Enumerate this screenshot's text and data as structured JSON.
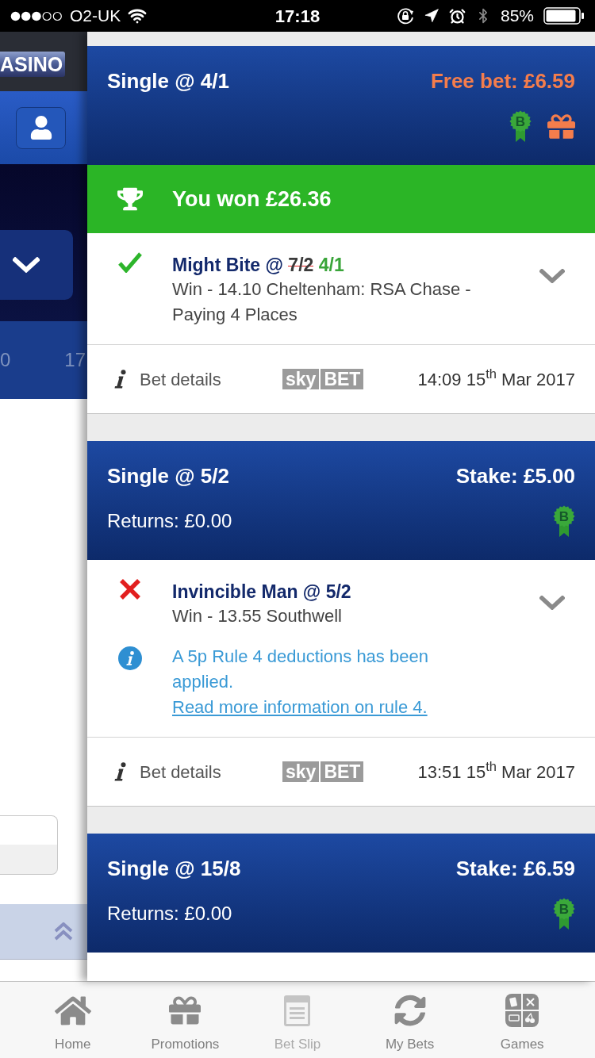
{
  "status_bar": {
    "carrier": "O2-UK",
    "time": "17:18",
    "battery": "85%"
  },
  "background_page": {
    "logo": "ASINO",
    "numbers": [
      "0",
      "17"
    ]
  },
  "bets": [
    {
      "kind": "free_bet",
      "title": "Single @ 4/1",
      "amount": "Free bet: £6.59",
      "badge": "B",
      "result_banner": "You won £26.36",
      "selection": {
        "kind": "won",
        "name": "Might Bite @",
        "old_odds": "7/2",
        "odds": "4/1",
        "price_changed": true,
        "description": "Win - 14.10 Cheltenham: RSA Chase - Paying 4 Places"
      },
      "details": {
        "label": "Bet details",
        "logo": [
          "sky",
          "BET"
        ],
        "placed": "14:09 15$^{th}$ Mar 2017"
      }
    },
    {
      "kind": "stake",
      "title": "Single @ 5/2",
      "amount": "Stake: £5.00",
      "returns": "Returns: £0.00",
      "badge": "B",
      "selection": {
        "kind": "lost",
        "name": "Invincible Man @",
        "odds": "5/2",
        "price_changed": false,
        "description": "Win - 13.55 Southwell",
        "note": "A 5p Rule 4 deductions has been applied.",
        "note_link": "Read more information on rule 4."
      },
      "details": {
        "label": "Bet details",
        "logo": [
          "sky",
          "BET"
        ],
        "placed": "13:51 15$^{th}$ Mar 2017"
      }
    },
    {
      "kind": "stake",
      "title": "Single @ 15/8",
      "amount": "Stake: £6.59",
      "returns": "Returns: £0.00",
      "badge": "B"
    }
  ],
  "tab_bar": [
    {
      "kind": "home",
      "label": "Home",
      "disabled": false
    },
    {
      "kind": "promotions",
      "label": "Promotions",
      "disabled": false
    },
    {
      "kind": "bet_slip",
      "label": "Bet Slip",
      "disabled": true
    },
    {
      "kind": "my_bets",
      "label": "My Bets",
      "disabled": false
    },
    {
      "kind": "games",
      "label": "Games",
      "disabled": false
    }
  ]
}
